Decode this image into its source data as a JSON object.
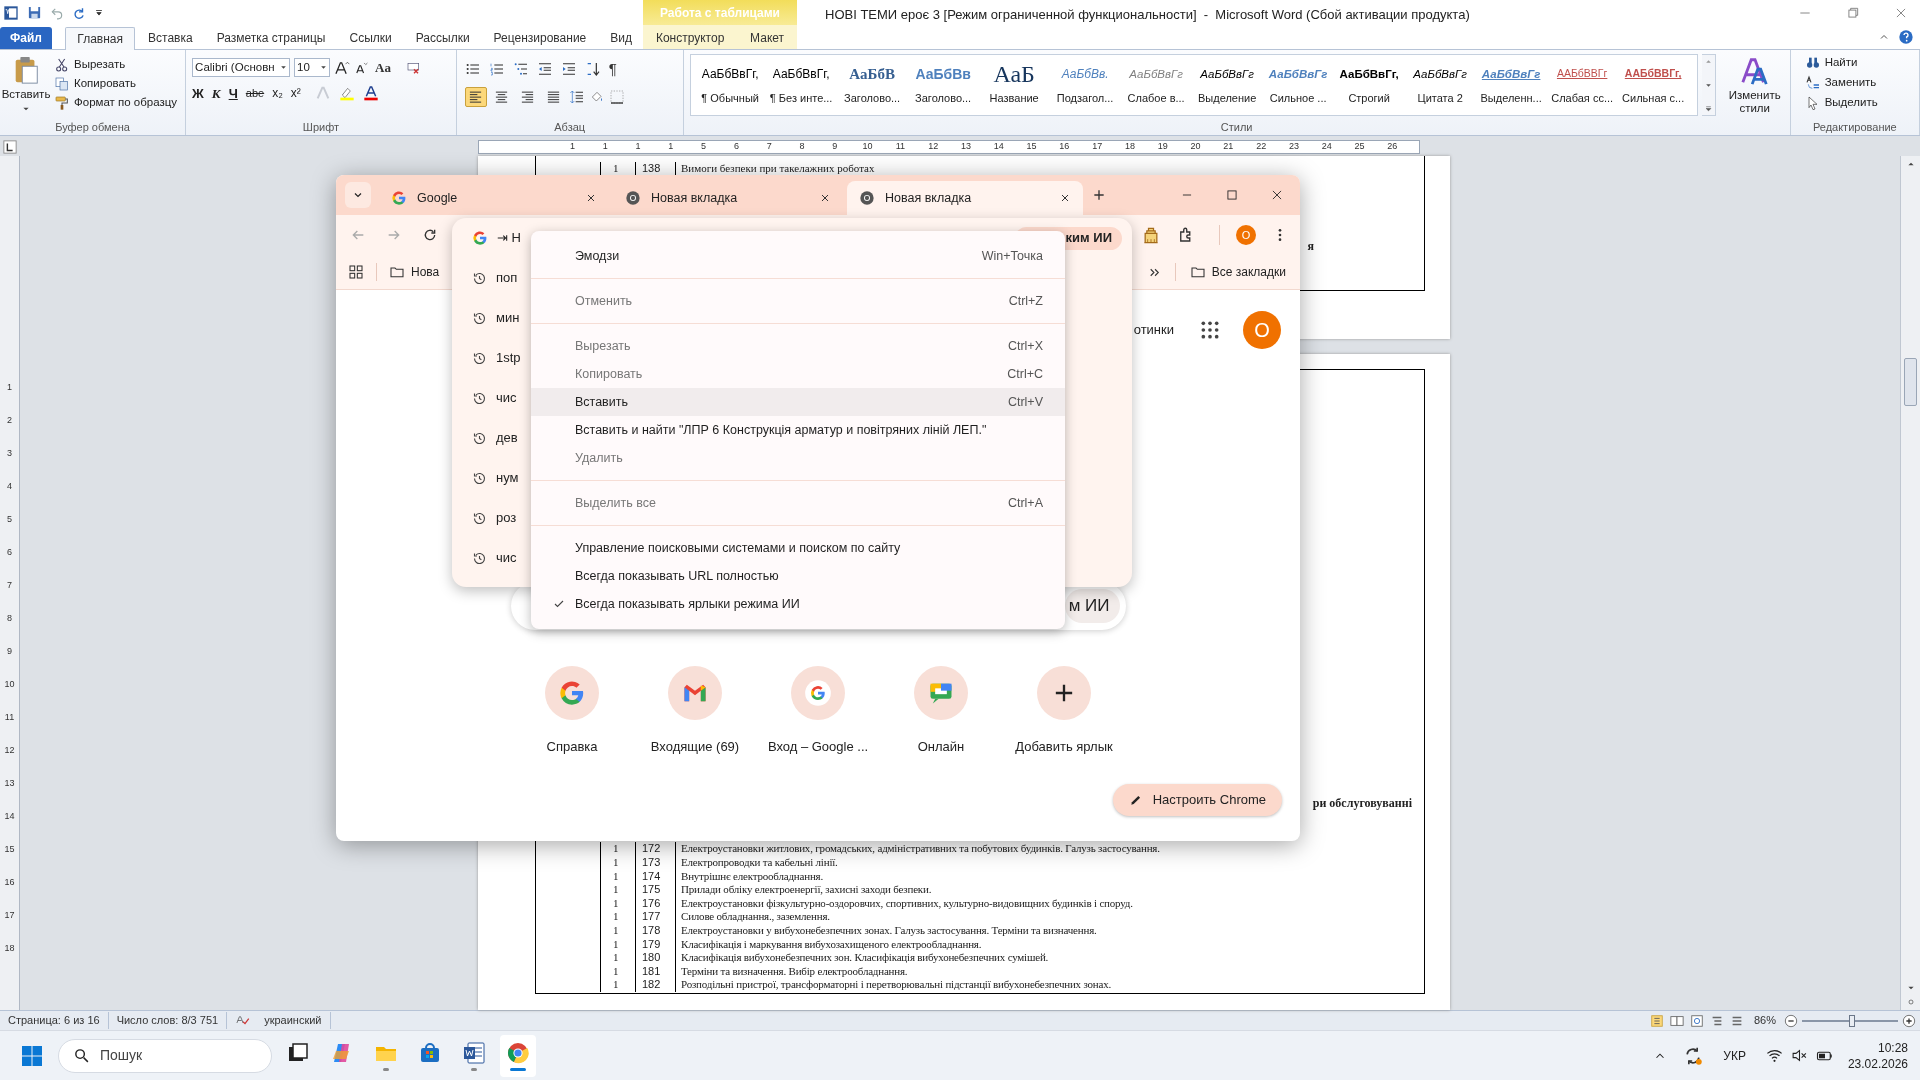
{
  "word": {
    "title": "НОВІ ТЕМИ ероє 3 [Режим ограниченной функциональности]  -  Microsoft Word (Сбой активации продукта)",
    "context_group": "Работа с таблицами",
    "tabs": [
      {
        "label": "Файл",
        "kind": "file",
        "selected": false
      },
      {
        "label": "Главная",
        "kind": "main",
        "selected": true
      },
      {
        "label": "Вставка",
        "kind": "main",
        "selected": false
      },
      {
        "label": "Разметка страницы",
        "kind": "main",
        "selected": false
      },
      {
        "label": "Ссылки",
        "kind": "main",
        "selected": false
      },
      {
        "label": "Рассылки",
        "kind": "main",
        "selected": false
      },
      {
        "label": "Рецензирование",
        "kind": "main",
        "selected": false
      },
      {
        "label": "Вид",
        "kind": "main",
        "selected": false
      },
      {
        "label": "Конструктор",
        "kind": "context",
        "selected": false
      },
      {
        "label": "Макет",
        "kind": "context",
        "selected": false
      }
    ],
    "clipboard": {
      "paste": "Вставить",
      "commands": [
        "Вырезать",
        "Копировать",
        "Формат по образцу"
      ],
      "group": "Буфер обмена"
    },
    "font": {
      "name": "Calibri (Основн",
      "size": "10",
      "case_button": "Aa",
      "format_buttons": [
        "Ж",
        "К",
        "Ч",
        "abe",
        "x₂",
        "x²"
      ],
      "group": "Шрифт"
    },
    "paragraph": {
      "pilcrow": "¶",
      "align": [
        {
          "kind": "left",
          "selected": true
        },
        {
          "kind": "center",
          "selected": false
        },
        {
          "kind": "right",
          "selected": false
        },
        {
          "kind": "justify",
          "selected": false
        }
      ],
      "group": "Абзац"
    },
    "styles": {
      "items": [
        {
          "sample": "АаБбВвГг,",
          "label": "¶ Обычный",
          "kind": "normal"
        },
        {
          "sample": "АаБбВвГг,",
          "label": "¶ Без инте...",
          "kind": "normal"
        },
        {
          "sample": "АаБбВ",
          "label": "Заголово...",
          "kind": "heading1"
        },
        {
          "sample": "АаБбВв",
          "label": "Заголово...",
          "kind": "heading2"
        },
        {
          "sample": "АаБ",
          "label": "Название",
          "kind": "title"
        },
        {
          "sample": "АаБбВв.",
          "label": "Подзагол...",
          "kind": "subtitle"
        },
        {
          "sample": "АаБбВвГг",
          "label": "Слабое в...",
          "kind": "subtle"
        },
        {
          "sample": "АаБбВвГг",
          "label": "Выделение",
          "kind": "emphasis"
        },
        {
          "sample": "АаБбВвГг",
          "label": "Сильное ...",
          "kind": "intense"
        },
        {
          "sample": "АаБбВвГг,",
          "label": "Строгий",
          "kind": "strong"
        },
        {
          "sample": "АаБбВвГг",
          "label": "Цитата 2",
          "kind": "emphasis"
        },
        {
          "sample": "АаБбВвГг",
          "label": "Выделенн...",
          "kind": "intensequote"
        },
        {
          "sample": "ААБбВВГг",
          "label": "Слабая сс...",
          "kind": "subtleref"
        },
        {
          "sample": "ААБбВВГг,",
          "label": "Сильная с...",
          "kind": "intenseref"
        }
      ],
      "change": "Изменить стили",
      "group": "Стили"
    },
    "editing": {
      "commands": [
        "Найти",
        "Заменить",
        "Выделить"
      ],
      "group": "Редактирование"
    },
    "ruler": {
      "labels": [
        "1",
        "1",
        "1",
        "1",
        "5",
        "6",
        "7",
        "8",
        "9",
        "10",
        "11",
        "12",
        "13",
        "14",
        "15",
        "16",
        "17",
        "18",
        "19",
        "20",
        "21",
        "22",
        "23",
        "24",
        "25",
        "26"
      ]
    },
    "vertical_ruler": {
      "labels": [
        "1",
        "2",
        "3",
        "4",
        "5",
        "6",
        "7",
        "8",
        "9",
        "10",
        "11",
        "12",
        "13",
        "14",
        "15",
        "16",
        "17",
        "18"
      ]
    },
    "page1": {
      "row": {
        "count": "1",
        "number": "138",
        "text": "Вимоги безпеки при такелажних роботах"
      },
      "fragment": "я"
    },
    "page2": {
      "fragment": "ри обслуговуванні",
      "rows": [
        {
          "count": "1",
          "number": "172",
          "text": "Електроустановки житлових, громадських, адміністративних та побутових будинків. Галузь застосування."
        },
        {
          "count": "1",
          "number": "173",
          "text": "Електропроводки та кабельні лінії."
        },
        {
          "count": "1",
          "number": "174",
          "text": "Внутрішнє електрообладнання."
        },
        {
          "count": "1",
          "number": "175",
          "text": "Прилади обліку електроенергії, захисні заходи безпеки."
        },
        {
          "count": "1",
          "number": "176",
          "text": "Електроустановки фізкультурно-оздоровчих, спортивних, культурно-видовищних будинків і споруд."
        },
        {
          "count": "1",
          "number": "177",
          "text": "Силове обладнання., заземлення."
        },
        {
          "count": "1",
          "number": "178",
          "text": "Електроустановки у вибухонебезпечних зонах. Галузь застосування. Терміни та визначення."
        },
        {
          "count": "1",
          "number": "179",
          "text": "Класифікація і маркування вибухозахищеного електрообладнання."
        },
        {
          "count": "1",
          "number": "180",
          "text": "Класифікація вибухонебезпечних зон. Класифікація вибухонебезпечних сумішей."
        },
        {
          "count": "1",
          "number": "181",
          "text": "Терміни та визначення. Вибір електрообладнання."
        },
        {
          "count": "1",
          "number": "182",
          "text": "Розподільні пристрої, трансформаторні і перетворювальні підстанції вибухонебезпечних зонах."
        }
      ]
    },
    "status_bar": {
      "page": "Страница: 6 из 16",
      "words": "Число слов: 8/3 751",
      "language": "украинский",
      "zoom": "86%",
      "zoom_slider": {
        "level": 0.52
      }
    }
  },
  "chrome": {
    "tabs": [
      {
        "title": "Google",
        "kind": "google",
        "selected": false
      },
      {
        "title": "Новая вкладка",
        "kind": "chrome",
        "selected": false
      },
      {
        "title": "Новая вкладка",
        "kind": "chrome",
        "selected": true
      }
    ],
    "omnibox": {
      "value": "⇥ Н",
      "ai_chip": "ким ИИ"
    },
    "profile": "О",
    "bookmark": "Нова",
    "all_bookmarks": "Все закладки",
    "suggestions": [
      "поп",
      "мин",
      "1stp",
      "чис",
      "дев",
      "нум",
      "роз",
      "чис"
    ],
    "menu": [
      {
        "kind": "item",
        "label": "Эмодзи",
        "shortcut": "Win+Точка",
        "disabled": false,
        "selected": false,
        "checked": false
      },
      {
        "kind": "separator"
      },
      {
        "kind": "item",
        "label": "Отменить",
        "shortcut": "Ctrl+Z",
        "disabled": true,
        "selected": false,
        "checked": false
      },
      {
        "kind": "separator"
      },
      {
        "kind": "item",
        "label": "Вырезать",
        "shortcut": "Ctrl+X",
        "disabled": true,
        "selected": false,
        "checked": false
      },
      {
        "kind": "item",
        "label": "Копировать",
        "shortcut": "Ctrl+C",
        "disabled": true,
        "selected": false,
        "checked": false
      },
      {
        "kind": "item",
        "label": "Вставить",
        "shortcut": "Ctrl+V",
        "disabled": false,
        "selected": true,
        "checked": false
      },
      {
        "kind": "item",
        "label": "Вставить и найти \"ЛПР 6 Конструкція арматур и повітряних ліній ЛЕП.\"",
        "disabled": false,
        "selected": false,
        "checked": false
      },
      {
        "kind": "item",
        "label": "Удалить",
        "disabled": true,
        "selected": false,
        "checked": false
      },
      {
        "kind": "separator"
      },
      {
        "kind": "item",
        "label": "Выделить все",
        "shortcut": "Ctrl+A",
        "disabled": true,
        "selected": false,
        "checked": false
      },
      {
        "kind": "separator"
      },
      {
        "kind": "item",
        "label": "Управление поисковыми системами и поиском по сайту",
        "disabled": false,
        "selected": false,
        "checked": false
      },
      {
        "kind": "item",
        "label": "Всегда показывать URL полностью",
        "disabled": false,
        "selected": false,
        "checked": false
      },
      {
        "kind": "item",
        "label": "Всегда показывать ярлыки режима ИИ",
        "disabled": false,
        "selected": false,
        "checked": true
      }
    ],
    "page": {
      "images_link": "отинки",
      "avatar": "О",
      "search_chip": "м ИИ",
      "shortcuts": [
        {
          "label": "Справка",
          "kind": "google"
        },
        {
          "label": "Входящие (69)",
          "kind": "gmail"
        },
        {
          "label": "Вход – Google ...",
          "kind": "google_white"
        },
        {
          "label": "Онлайн",
          "kind": "chat"
        },
        {
          "label": "Добавить ярлык",
          "kind": "add"
        }
      ],
      "customize": "Настроить Chrome"
    }
  },
  "taskbar": {
    "search": "Пошук",
    "apps": [
      {
        "kind": "taskview",
        "running": false,
        "active": false
      },
      {
        "kind": "copilot",
        "running": false,
        "active": false
      },
      {
        "kind": "explorer",
        "running": true,
        "active": false
      },
      {
        "kind": "store",
        "running": false,
        "active": false
      },
      {
        "kind": "word",
        "running": true,
        "active": false
      },
      {
        "kind": "chrome",
        "running": true,
        "active": true
      }
    ],
    "language": "УКР",
    "time": "10:28",
    "date": "23.02.2026"
  }
}
